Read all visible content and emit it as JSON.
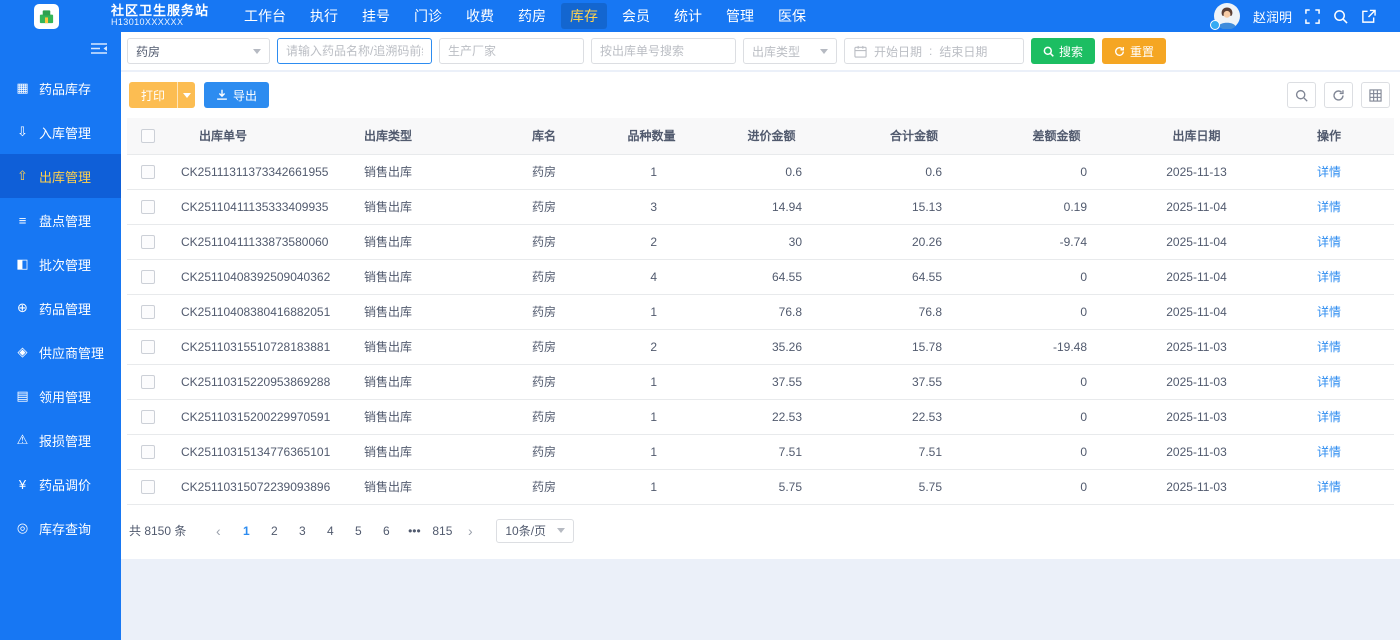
{
  "header": {
    "title": "社区卫生服务站",
    "subtitle": "H13010XXXXXX",
    "nav": [
      {
        "label": "工作台"
      },
      {
        "label": "执行"
      },
      {
        "label": "挂号"
      },
      {
        "label": "门诊"
      },
      {
        "label": "收费"
      },
      {
        "label": "药房"
      },
      {
        "label": "库存",
        "active": true
      },
      {
        "label": "会员"
      },
      {
        "label": "统计"
      },
      {
        "label": "管理"
      },
      {
        "label": "医保"
      }
    ],
    "user_name": "赵润明",
    "header_icons": [
      "fullscreen-icon",
      "search-icon",
      "external-link-icon"
    ]
  },
  "sidebar": {
    "collapse_icon": "collapse-menu-icon",
    "items": [
      {
        "label": "药品库存",
        "icon": "inventory-icon",
        "glyph": "▦"
      },
      {
        "label": "入库管理",
        "icon": "inbound-icon",
        "glyph": "⇩"
      },
      {
        "label": "出库管理",
        "icon": "outbound-icon",
        "glyph": "⇧",
        "active": true
      },
      {
        "label": "盘点管理",
        "icon": "stocktake-icon",
        "glyph": "≡"
      },
      {
        "label": "批次管理",
        "icon": "batch-icon",
        "glyph": "◧"
      },
      {
        "label": "药品管理",
        "icon": "drug-icon",
        "glyph": "⊕"
      },
      {
        "label": "供应商管理",
        "icon": "supplier-icon",
        "glyph": "◈"
      },
      {
        "label": "领用管理",
        "icon": "requisition-icon",
        "glyph": "▤"
      },
      {
        "label": "报损管理",
        "icon": "damage-icon",
        "glyph": "⚠"
      },
      {
        "label": "药品调价",
        "icon": "price-adjust-icon",
        "glyph": "¥"
      },
      {
        "label": "库存查询",
        "icon": "stock-query-icon",
        "glyph": "◎"
      }
    ]
  },
  "filters": {
    "warehouse_value": "药房",
    "drug_placeholder": "请输入药品名称/追溯码前缀",
    "manufacturer_placeholder": "生产厂家",
    "order_placeholder": "按出库单号搜索",
    "type_placeholder": "出库类型",
    "start_placeholder": "开始日期",
    "range_separator": ":",
    "end_placeholder": "结束日期",
    "search_label": "搜索",
    "reset_label": "重置"
  },
  "toolbar": {
    "print_label": "打印",
    "export_label": "导出",
    "mini_buttons": [
      "search-icon",
      "refresh-icon",
      "grid-icon"
    ]
  },
  "table": {
    "headers": [
      "出库单号",
      "出库类型",
      "库名",
      "品种数量",
      "进价金额",
      "合计金额",
      "差额金额",
      "出库日期",
      "操作"
    ],
    "detail_label": "详情",
    "rows": [
      {
        "order_no": "CK25111311373342661955",
        "type": "销售出库",
        "warehouse": "药房",
        "qty": "1",
        "cost": "0.6",
        "total": "0.6",
        "diff": "0",
        "date": "2025-11-13"
      },
      {
        "order_no": "CK25110411135333409935",
        "type": "销售出库",
        "warehouse": "药房",
        "qty": "3",
        "cost": "14.94",
        "total": "15.13",
        "diff": "0.19",
        "date": "2025-11-04"
      },
      {
        "order_no": "CK25110411133873580060",
        "type": "销售出库",
        "warehouse": "药房",
        "qty": "2",
        "cost": "30",
        "total": "20.26",
        "diff": "-9.74",
        "date": "2025-11-04"
      },
      {
        "order_no": "CK25110408392509040362",
        "type": "销售出库",
        "warehouse": "药房",
        "qty": "4",
        "cost": "64.55",
        "total": "64.55",
        "diff": "0",
        "date": "2025-11-04"
      },
      {
        "order_no": "CK25110408380416882051",
        "type": "销售出库",
        "warehouse": "药房",
        "qty": "1",
        "cost": "76.8",
        "total": "76.8",
        "diff": "0",
        "date": "2025-11-04"
      },
      {
        "order_no": "CK25110315510728183881",
        "type": "销售出库",
        "warehouse": "药房",
        "qty": "2",
        "cost": "35.26",
        "total": "15.78",
        "diff": "-19.48",
        "date": "2025-11-03"
      },
      {
        "order_no": "CK25110315220953869288",
        "type": "销售出库",
        "warehouse": "药房",
        "qty": "1",
        "cost": "37.55",
        "total": "37.55",
        "diff": "0",
        "date": "2025-11-03"
      },
      {
        "order_no": "CK25110315200229970591",
        "type": "销售出库",
        "warehouse": "药房",
        "qty": "1",
        "cost": "22.53",
        "total": "22.53",
        "diff": "0",
        "date": "2025-11-03"
      },
      {
        "order_no": "CK25110315134776365101",
        "type": "销售出库",
        "warehouse": "药房",
        "qty": "1",
        "cost": "7.51",
        "total": "7.51",
        "diff": "0",
        "date": "2025-11-03"
      },
      {
        "order_no": "CK25110315072239093896",
        "type": "销售出库",
        "warehouse": "药房",
        "qty": "1",
        "cost": "5.75",
        "total": "5.75",
        "diff": "0",
        "date": "2025-11-03"
      }
    ]
  },
  "pagination": {
    "total_label": "共 8150 条",
    "prev_glyph": "‹",
    "next_glyph": "›",
    "pages": [
      {
        "label": "1",
        "active": true
      },
      {
        "label": "2"
      },
      {
        "label": "3"
      },
      {
        "label": "4"
      },
      {
        "label": "5"
      },
      {
        "label": "6"
      },
      {
        "label": "•••"
      },
      {
        "label": "815"
      }
    ],
    "page_size_label": "10条/页"
  },
  "colors": {
    "primary_blue": "#1777f3",
    "link_blue": "#2d8cf0",
    "success_green": "#1cbe62",
    "warning_orange": "#f5a623",
    "print_orange": "#fcbd52",
    "active_gold": "#ffd04c"
  }
}
